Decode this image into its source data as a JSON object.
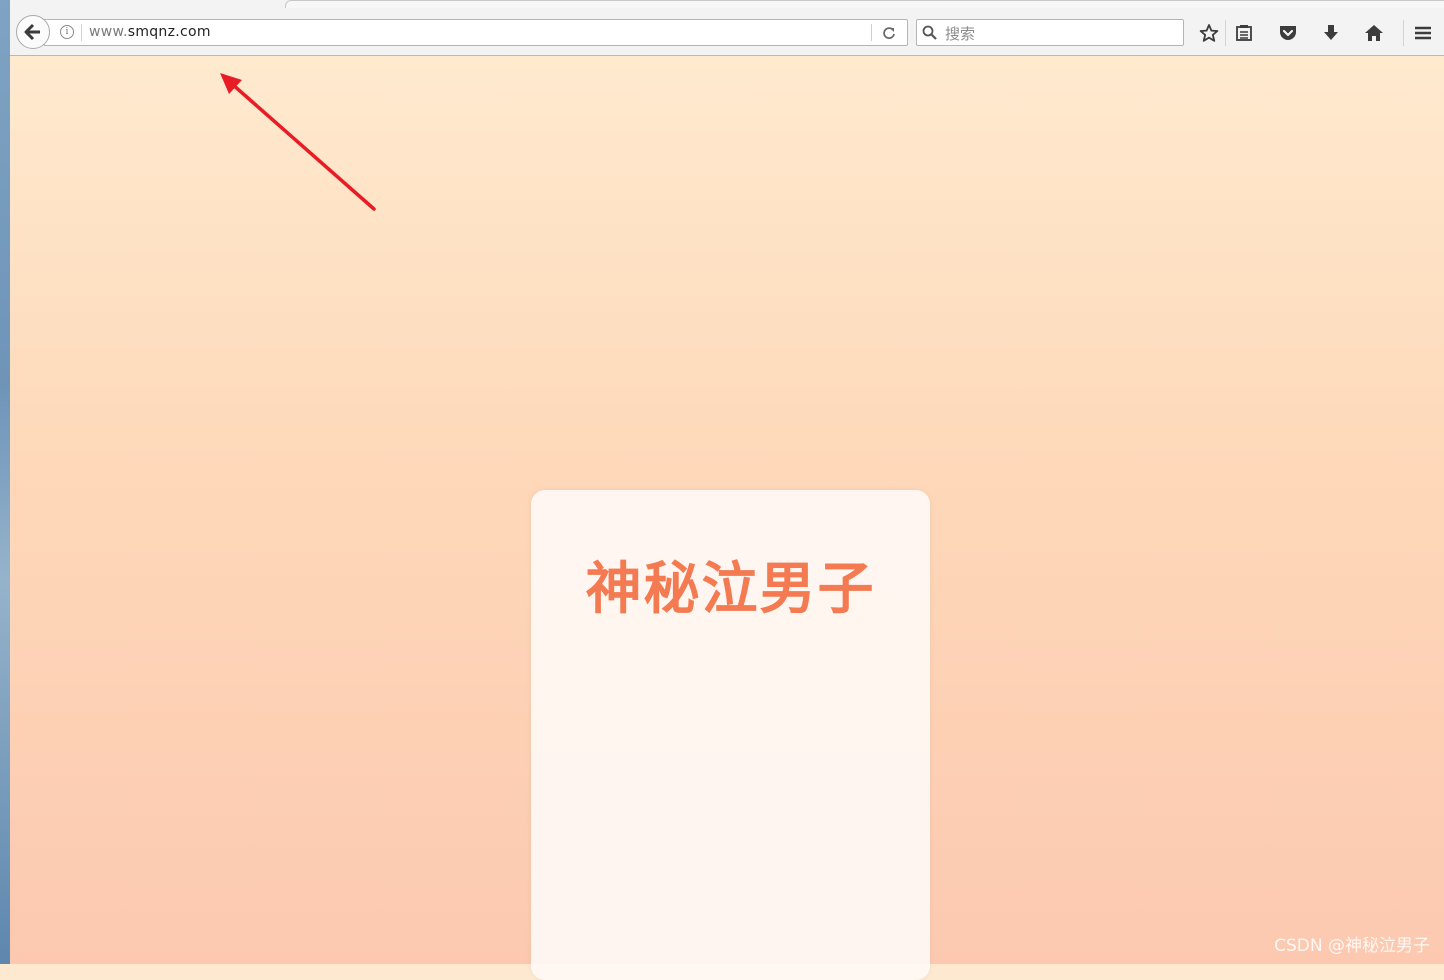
{
  "browser": {
    "url": {
      "prefix": "www.",
      "domain": "smqnz.com"
    },
    "search": {
      "placeholder": "搜索"
    },
    "icons": [
      "back-arrow-icon",
      "info-icon",
      "reload-icon",
      "search-icon",
      "bookmark-star-icon",
      "reading-list-icon",
      "pocket-icon",
      "download-icon",
      "home-icon",
      "menu-icon"
    ]
  },
  "page": {
    "card_title": "神秘泣男子",
    "title_color": "#f47a52"
  },
  "annotation": {
    "arrow_color": "#e81c24"
  },
  "watermark": "CSDN @神秘泣男子"
}
